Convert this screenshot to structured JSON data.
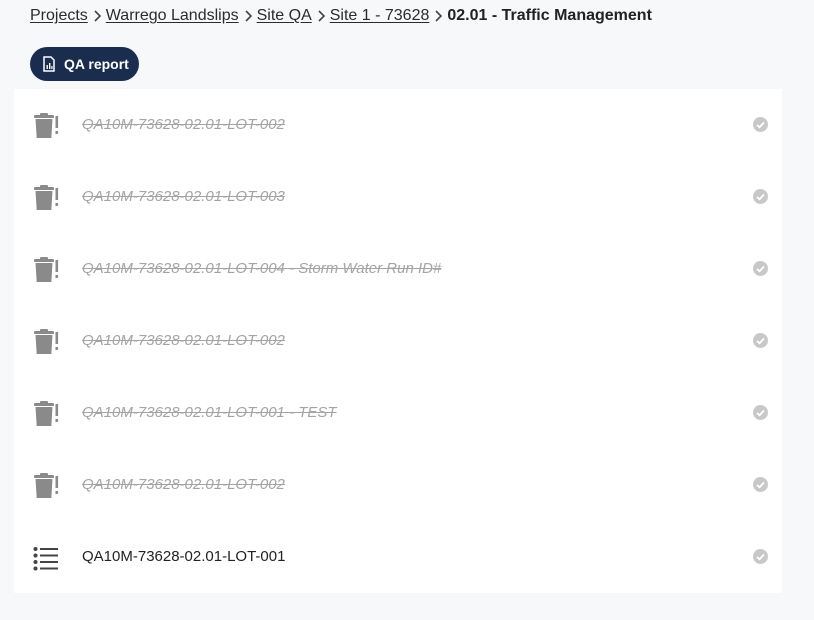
{
  "breadcrumb": {
    "items": [
      "Projects",
      "Warrego Landslips",
      "Site QA",
      "Site 1 - 73628"
    ],
    "current": "02.01 - Traffic Management",
    "separator_icon": "chevron-right-icon"
  },
  "toolbar": {
    "qa_report_label": "QA report",
    "qa_report_icon": "report-document-icon",
    "button_color": "#1b2d4f"
  },
  "lots": [
    {
      "title": "QA10M-73628-02.01-LOT-002",
      "state": "deleted",
      "icon": "trash-warning-icon",
      "status_icon": "check-circle-icon"
    },
    {
      "title": "QA10M-73628-02.01-LOT-003",
      "state": "deleted",
      "icon": "trash-warning-icon",
      "status_icon": "check-circle-icon"
    },
    {
      "title": "QA10M-73628-02.01-LOT-004 - Storm Water Run ID#",
      "state": "deleted",
      "icon": "trash-warning-icon",
      "status_icon": "check-circle-icon"
    },
    {
      "title": "QA10M-73628-02.01-LOT-002",
      "state": "deleted",
      "icon": "trash-warning-icon",
      "status_icon": "check-circle-icon"
    },
    {
      "title": "QA10M-73628-02.01-LOT-001 - TEST",
      "state": "deleted",
      "icon": "trash-warning-icon",
      "status_icon": "check-circle-icon"
    },
    {
      "title": "QA10M-73628-02.01-LOT-002",
      "state": "deleted",
      "icon": "trash-warning-icon",
      "status_icon": "check-circle-icon"
    },
    {
      "title": "QA10M-73628-02.01-LOT-001",
      "state": "active",
      "icon": "list-icon",
      "status_icon": "check-circle-icon"
    }
  ],
  "colors": {
    "deleted_text": "#a4a4a4",
    "active_text": "#222222",
    "icon_grey": "#8a8a8a",
    "status_grey": "#c8c8c8"
  }
}
